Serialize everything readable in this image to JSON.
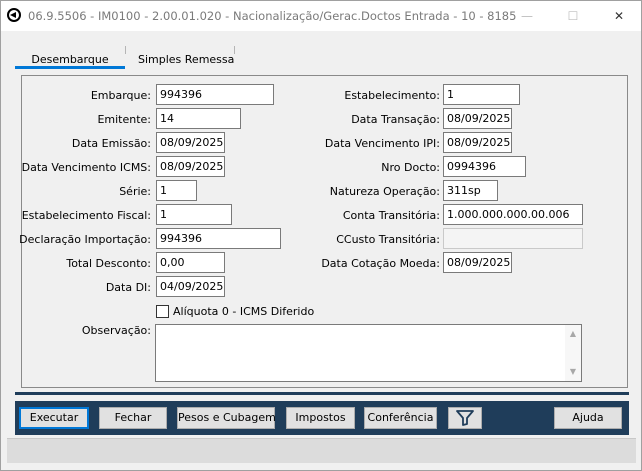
{
  "window": {
    "title": "06.9.5506 - IM0100 - 2.00.01.020 - Nacionalização/Gerac.Doctos Entrada - 10 - 8185",
    "minimize": "—",
    "maximize": "☐",
    "close": "✕"
  },
  "tabs": [
    {
      "label": "Desembarque",
      "active": true
    },
    {
      "label": "Simples Remessa",
      "active": false
    }
  ],
  "form": {
    "embarque": {
      "label": "Embarque:",
      "value": "994396"
    },
    "emitente": {
      "label": "Emitente:",
      "value": "14"
    },
    "data_emissao": {
      "label": "Data Emissão:",
      "value": "08/09/2025"
    },
    "data_venc_icms": {
      "label": "Data Vencimento ICMS:",
      "value": "08/09/2025"
    },
    "serie": {
      "label": "Série:",
      "value": "1"
    },
    "estab_fiscal": {
      "label": "Estabelecimento Fiscal:",
      "value": "1"
    },
    "decl_importacao": {
      "label": "Declaração Importação:",
      "value": "994396"
    },
    "total_desconto": {
      "label": "Total Desconto:",
      "value": "0,00"
    },
    "data_di": {
      "label": "Data DI:",
      "value": "04/09/2025"
    },
    "estabelecimento": {
      "label": "Estabelecimento:",
      "value": "1"
    },
    "data_transacao": {
      "label": "Data Transação:",
      "value": "08/09/2025"
    },
    "data_venc_ipi": {
      "label": "Data Vencimento IPI:",
      "value": "08/09/2025"
    },
    "nro_docto": {
      "label": "Nro Docto:",
      "value": "0994396"
    },
    "natureza_operacao": {
      "label": "Natureza Operação:",
      "value": "311sp"
    },
    "conta_transitoria": {
      "label": "Conta Transitória:",
      "value": "1.000.000.000.00.006"
    },
    "ccusto_transitoria": {
      "label": "CCusto Transitória:",
      "value": ""
    },
    "data_cotacao_moeda": {
      "label": "Data Cotação Moeda:",
      "value": "08/09/2025"
    },
    "aliquota_checkbox": {
      "label": "Alíquota 0 - ICMS Diferido",
      "checked": false
    },
    "observacao": {
      "label": "Observação:",
      "value": ""
    }
  },
  "buttons": {
    "executar": "Executar",
    "fechar": "Fechar",
    "pesos": "Pesos e Cubagem",
    "impostos": "Impostos",
    "conferencia": "Conferência",
    "filter_icon": "filter-icon",
    "ajuda": "Ajuda"
  },
  "colors": {
    "button_bar": "#1f3d5a",
    "tab_accent": "#0078d7"
  }
}
